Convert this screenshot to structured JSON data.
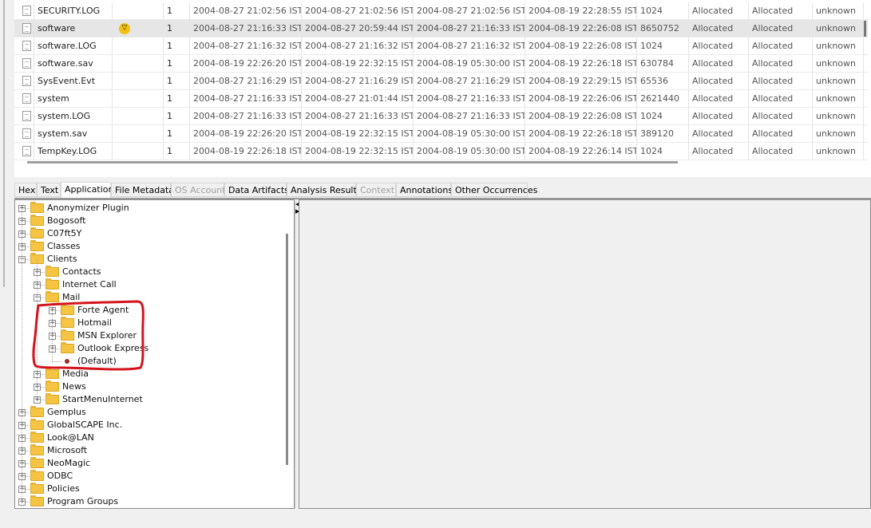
{
  "file_table": {
    "rows": [
      {
        "name": "SECURITY.LOG",
        "flag": "",
        "count": "1",
        "modified": "2004-08-27 21:02:56 IST",
        "changed": "2004-08-27 21:02:56 IST",
        "accessed": "2004-08-27 21:02:56 IST",
        "created": "2004-08-19 22:28:55 IST",
        "size": "1024",
        "dir_flags": "Allocated",
        "meta_flags": "Allocated",
        "known": "unknown"
      },
      {
        "name": "software",
        "flag": "▽",
        "count": "1",
        "modified": "2004-08-27 21:16:33 IST",
        "changed": "2004-08-27 20:59:44 IST",
        "accessed": "2004-08-27 21:16:33 IST",
        "created": "2004-08-19 22:26:08 IST",
        "size": "8650752",
        "dir_flags": "Allocated",
        "meta_flags": "Allocated",
        "known": "unknown",
        "selected": true
      },
      {
        "name": "software.LOG",
        "flag": "",
        "count": "1",
        "modified": "2004-08-27 21:16:32 IST",
        "changed": "2004-08-27 21:16:32 IST",
        "accessed": "2004-08-27 21:16:32 IST",
        "created": "2004-08-19 22:26:08 IST",
        "size": "1024",
        "dir_flags": "Allocated",
        "meta_flags": "Allocated",
        "known": "unknown"
      },
      {
        "name": "software.sav",
        "flag": "",
        "count": "1",
        "modified": "2004-08-19 22:26:20 IST",
        "changed": "2004-08-19 22:32:15 IST",
        "accessed": "2004-08-19 05:30:00 IST",
        "created": "2004-08-19 22:26:18 IST",
        "size": "630784",
        "dir_flags": "Allocated",
        "meta_flags": "Allocated",
        "known": "unknown"
      },
      {
        "name": "SysEvent.Evt",
        "flag": "",
        "count": "1",
        "modified": "2004-08-27 21:16:29 IST",
        "changed": "2004-08-27 21:16:29 IST",
        "accessed": "2004-08-27 21:16:29 IST",
        "created": "2004-08-19 22:29:15 IST",
        "size": "65536",
        "dir_flags": "Allocated",
        "meta_flags": "Allocated",
        "known": "unknown"
      },
      {
        "name": "system",
        "flag": "",
        "count": "1",
        "modified": "2004-08-27 21:16:33 IST",
        "changed": "2004-08-27 21:01:44 IST",
        "accessed": "2004-08-27 21:16:33 IST",
        "created": "2004-08-19 22:26:06 IST",
        "size": "2621440",
        "dir_flags": "Allocated",
        "meta_flags": "Allocated",
        "known": "unknown"
      },
      {
        "name": "system.LOG",
        "flag": "",
        "count": "1",
        "modified": "2004-08-27 21:16:33 IST",
        "changed": "2004-08-27 21:16:33 IST",
        "accessed": "2004-08-27 21:16:33 IST",
        "created": "2004-08-19 22:26:08 IST",
        "size": "1024",
        "dir_flags": "Allocated",
        "meta_flags": "Allocated",
        "known": "unknown"
      },
      {
        "name": "system.sav",
        "flag": "",
        "count": "1",
        "modified": "2004-08-19 22:26:20 IST",
        "changed": "2004-08-19 22:32:15 IST",
        "accessed": "2004-08-19 05:30:00 IST",
        "created": "2004-08-19 22:26:18 IST",
        "size": "389120",
        "dir_flags": "Allocated",
        "meta_flags": "Allocated",
        "known": "unknown"
      },
      {
        "name": "TempKey.LOG",
        "flag": "",
        "count": "1",
        "modified": "2004-08-19 22:26:18 IST",
        "changed": "2004-08-19 22:32:15 IST",
        "accessed": "2004-08-19 05:30:00 IST",
        "created": "2004-08-19 22:26:14 IST",
        "size": "1024",
        "dir_flags": "Allocated",
        "meta_flags": "Allocated",
        "known": "unknown"
      }
    ]
  },
  "tabs": [
    {
      "label": "Hex",
      "state": "normal"
    },
    {
      "label": "Text",
      "state": "normal"
    },
    {
      "label": "Application",
      "state": "active"
    },
    {
      "label": "File Metadata",
      "state": "normal"
    },
    {
      "label": "OS Account",
      "state": "disabled"
    },
    {
      "label": "Data Artifacts",
      "state": "normal"
    },
    {
      "label": "Analysis Results",
      "state": "normal"
    },
    {
      "label": "Context",
      "state": "disabled"
    },
    {
      "label": "Annotations",
      "state": "normal"
    },
    {
      "label": "Other Occurrences",
      "state": "normal"
    }
  ],
  "tree": [
    {
      "label": "Anonymizer Plugin",
      "depth": 0,
      "expander": "+",
      "type": "folder"
    },
    {
      "label": "Bogosoft",
      "depth": 0,
      "expander": "+",
      "type": "folder"
    },
    {
      "label": "C07ft5Y",
      "depth": 0,
      "expander": "+",
      "type": "folder"
    },
    {
      "label": "Classes",
      "depth": 0,
      "expander": "+",
      "type": "folder"
    },
    {
      "label": "Clients",
      "depth": 0,
      "expander": "−",
      "type": "folder"
    },
    {
      "label": "Contacts",
      "depth": 1,
      "expander": "+",
      "type": "folder"
    },
    {
      "label": "Internet Call",
      "depth": 1,
      "expander": "+",
      "type": "folder"
    },
    {
      "label": "Mail",
      "depth": 1,
      "expander": "−",
      "type": "folder"
    },
    {
      "label": "Forte Agent",
      "depth": 2,
      "expander": "+",
      "type": "folder"
    },
    {
      "label": "Hotmail",
      "depth": 2,
      "expander": "+",
      "type": "folder"
    },
    {
      "label": "MSN Explorer",
      "depth": 2,
      "expander": "+",
      "type": "folder"
    },
    {
      "label": "Outlook Express",
      "depth": 2,
      "expander": "+",
      "type": "folder"
    },
    {
      "label": "(Default)",
      "depth": 2,
      "expander": "",
      "type": "value"
    },
    {
      "label": "Media",
      "depth": 1,
      "expander": "+",
      "type": "folder"
    },
    {
      "label": "News",
      "depth": 1,
      "expander": "+",
      "type": "folder"
    },
    {
      "label": "StartMenuInternet",
      "depth": 1,
      "expander": "+",
      "type": "folder"
    },
    {
      "label": "Gemplus",
      "depth": 0,
      "expander": "+",
      "type": "folder"
    },
    {
      "label": "GlobalSCAPE Inc.",
      "depth": 0,
      "expander": "+",
      "type": "folder"
    },
    {
      "label": "Look@LAN",
      "depth": 0,
      "expander": "+",
      "type": "folder"
    },
    {
      "label": "Microsoft",
      "depth": 0,
      "expander": "+",
      "type": "folder"
    },
    {
      "label": "NeoMagic",
      "depth": 0,
      "expander": "+",
      "type": "folder"
    },
    {
      "label": "ODBC",
      "depth": 0,
      "expander": "+",
      "type": "folder"
    },
    {
      "label": "Policies",
      "depth": 0,
      "expander": "+",
      "type": "folder"
    },
    {
      "label": "Program Groups",
      "depth": 0,
      "expander": "+",
      "type": "folder"
    }
  ],
  "colors": {
    "annotation": "#d4141c",
    "folder": "#f5c443",
    "selected_row": "#e6e6e6"
  }
}
